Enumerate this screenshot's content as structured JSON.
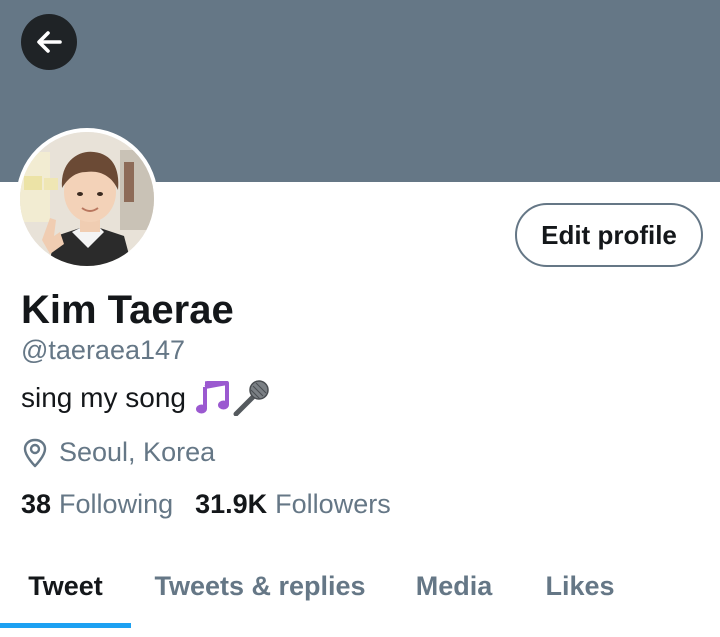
{
  "header": {
    "banner_color": "#657786",
    "back_icon": "arrow-left-icon"
  },
  "profile": {
    "avatar_icon": "avatar-photo",
    "edit_button_label": "Edit profile",
    "display_name": "Kim Taerae",
    "handle": "@taeraea147",
    "bio_text": "sing my song",
    "bio_emojis": [
      "musical-notes-emoji",
      "microphone-emoji"
    ],
    "location_icon": "location-pin-icon",
    "location": "Seoul, Korea"
  },
  "stats": {
    "following_count": "38",
    "following_label": "Following",
    "followers_count": "31.9K",
    "followers_label": "Followers"
  },
  "tabs": [
    {
      "label": "Tweet",
      "active": true
    },
    {
      "label": "Tweets & replies",
      "active": false
    },
    {
      "label": "Media",
      "active": false
    },
    {
      "label": "Likes",
      "active": false
    }
  ],
  "colors": {
    "accent": "#1da1f2",
    "secondary_text": "#657786",
    "primary_text": "#14171a"
  }
}
